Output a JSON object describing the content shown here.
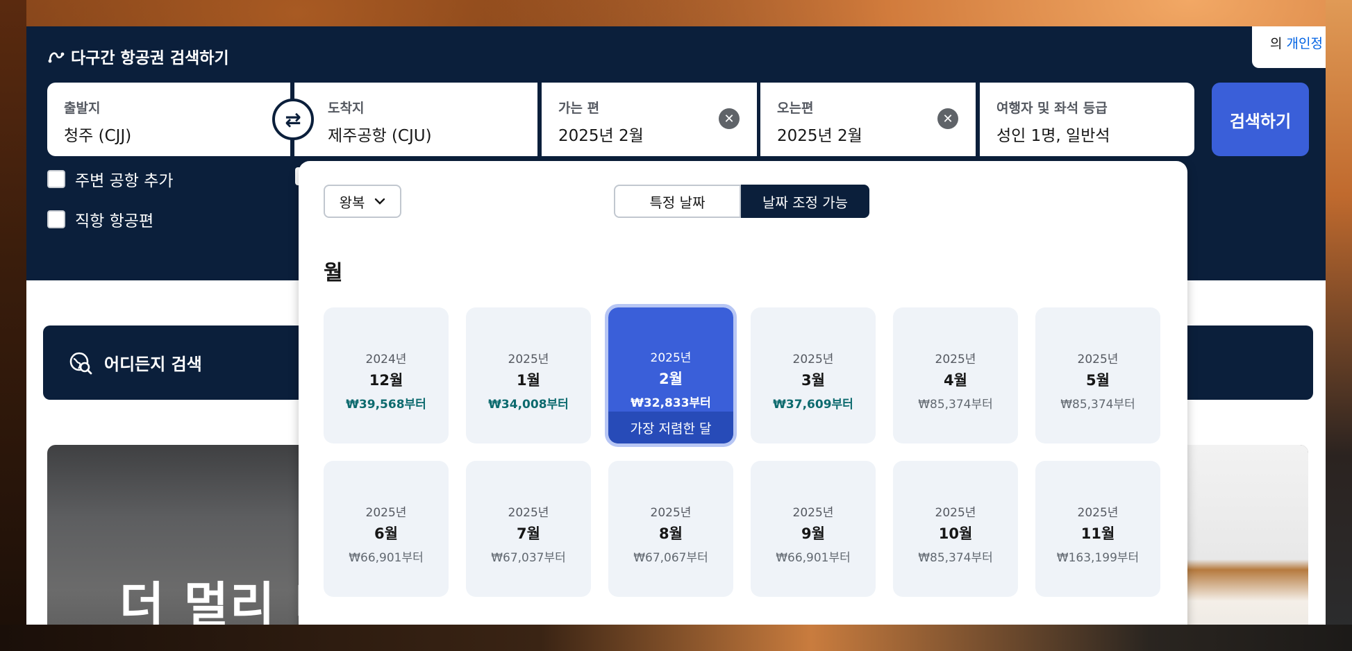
{
  "header": {
    "title": "다구간 항공권 검색하기",
    "privacy_prefix": "의",
    "privacy_link": "개인정"
  },
  "search": {
    "origin": {
      "label": "출발지",
      "value": "청주 (CJJ)"
    },
    "destination": {
      "label": "도착지",
      "value": "제주공항 (CJU)"
    },
    "depart": {
      "label": "가는 편",
      "value": "2025년 2월"
    },
    "return": {
      "label": "오는편",
      "value": "2025년 2월"
    },
    "travellers": {
      "label": "여행자 및 좌석 등급",
      "value": "성인 1명, 일반석"
    },
    "search_button": "검색하기",
    "swap_glyph": "⇄",
    "clear_glyph": "✕"
  },
  "options": {
    "nearby_airports": "주변 공항 추가",
    "direct_flights": "직항 항공편"
  },
  "everywhere": {
    "label": "어디든지 검색"
  },
  "banner": {
    "text": "더 멀리 더"
  },
  "picker": {
    "trip_type": "왕복",
    "toggle": [
      "특정 날짜",
      "날짜 조정 가능"
    ],
    "active_toggle": "날짜 조정 가능",
    "section_title": "월",
    "selected_tag": "가장 저렴한 달",
    "months": [
      {
        "year": "2024년",
        "month": "12월",
        "price": "₩39,568부터",
        "cheap": true
      },
      {
        "year": "2025년",
        "month": "1월",
        "price": "₩34,008부터",
        "cheap": true
      },
      {
        "year": "2025년",
        "month": "2월",
        "price": "₩32,833부터",
        "cheap": true,
        "selected": true
      },
      {
        "year": "2025년",
        "month": "3월",
        "price": "₩37,609부터",
        "cheap": true
      },
      {
        "year": "2025년",
        "month": "4월",
        "price": "₩85,374부터",
        "cheap": false
      },
      {
        "year": "2025년",
        "month": "5월",
        "price": "₩85,374부터",
        "cheap": false
      },
      {
        "year": "2025년",
        "month": "6월",
        "price": "₩66,901부터",
        "cheap": false
      },
      {
        "year": "2025년",
        "month": "7월",
        "price": "₩67,037부터",
        "cheap": false
      },
      {
        "year": "2025년",
        "month": "8월",
        "price": "₩67,067부터",
        "cheap": false
      },
      {
        "year": "2025년",
        "month": "9월",
        "price": "₩66,901부터",
        "cheap": false
      },
      {
        "year": "2025년",
        "month": "10월",
        "price": "₩85,374부터",
        "cheap": false
      },
      {
        "year": "2025년",
        "month": "11월",
        "price": "₩163,199부터",
        "cheap": false
      }
    ]
  },
  "colors": {
    "navy": "#0b1f3b",
    "primary_blue": "#3a5fd9",
    "cheap_price": "#0c6a6e"
  }
}
